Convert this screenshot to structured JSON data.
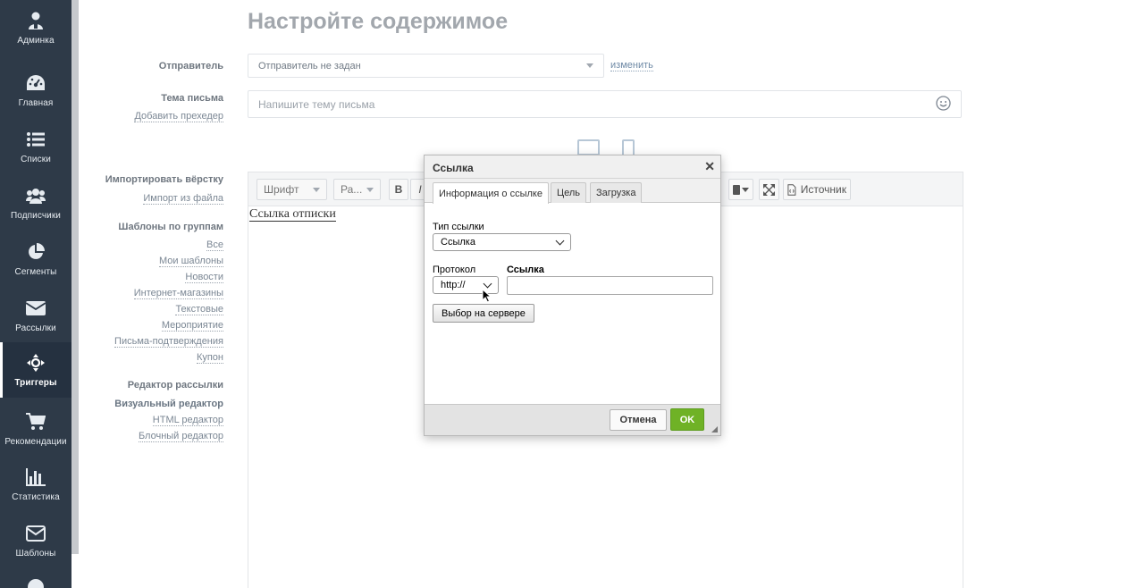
{
  "sidebar": {
    "items": [
      {
        "label": "Админка",
        "icon": "admin-icon"
      },
      {
        "label": "Главная",
        "icon": "dashboard-icon"
      },
      {
        "label": "Списки",
        "icon": "list-icon"
      },
      {
        "label": "Подписчики",
        "icon": "users-icon"
      },
      {
        "label": "Сегменты",
        "icon": "pie-chart-icon"
      },
      {
        "label": "Рассылки",
        "icon": "envelope-icon"
      },
      {
        "label": "Триггеры",
        "icon": "triggers-icon",
        "active": true
      },
      {
        "label": "Рекомендации",
        "icon": "cart-icon"
      },
      {
        "label": "Статистика",
        "icon": "bar-chart-icon"
      },
      {
        "label": "Шаблоны",
        "icon": "mail-template-icon"
      }
    ]
  },
  "page": {
    "title": "Настройте содержимое"
  },
  "form": {
    "sender_label": "Отправитель",
    "sender_value": "Отправитель не задан",
    "change_link": "изменить",
    "subject_label": "Тема письма",
    "add_preheader": "Добавить прехедер",
    "subject_placeholder": "Напишите тему письма"
  },
  "left_panel": {
    "import_heading": "Импортировать вёрстку",
    "import_from_file": "Импорт из файла",
    "templates_heading": "Шаблоны по группам",
    "template_groups": [
      "Все",
      "Мои шаблоны",
      "Новости",
      "Интернет-магазины",
      "Текстовые",
      "Мероприятие",
      "Письма-подтверждения",
      "Купон"
    ],
    "editor_heading": "Редактор рассылки",
    "editors": [
      "Визуальный редактор",
      "HTML редактор",
      "Блочный редактор"
    ]
  },
  "toolbar": {
    "font_label": "Шрифт",
    "size_label": "Ра...",
    "bold": "B",
    "italic": "I",
    "source_label": "Источник"
  },
  "editor": {
    "content_text": "Ссылка отписки"
  },
  "dialog": {
    "title": "Ссылка",
    "close": "✕",
    "tabs": [
      "Информация о ссылке",
      "Цель",
      "Загрузка"
    ],
    "link_type_label": "Тип ссылки",
    "link_type_value": "Ссылка",
    "protocol_label": "Протокол",
    "protocol_value": "http://",
    "url_label": "Ссылка",
    "url_value": "",
    "browse_server": "Выбор на сервере",
    "cancel": "Отмена",
    "ok": "OK"
  },
  "colors": {
    "sidebar": "#2e3a48",
    "ok_button": "#6fb226",
    "title": "#a2a7ad"
  }
}
